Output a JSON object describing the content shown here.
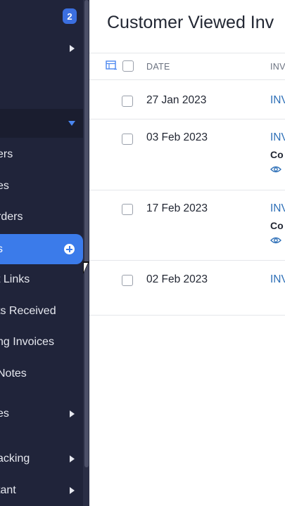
{
  "sidebar": {
    "badge": "2",
    "items": [
      {
        "label": "ers"
      },
      {
        "label": "es"
      },
      {
        "label": "rders"
      },
      {
        "label": "s"
      },
      {
        "label": "t Links"
      },
      {
        "label": "ts Received"
      },
      {
        "label": "ng Invoices"
      },
      {
        "label": "Notes"
      },
      {
        "label": "es"
      },
      {
        "label": "acking"
      },
      {
        "label": "tant"
      }
    ]
  },
  "main": {
    "title": "Customer Viewed Inv",
    "columns": {
      "date": "DATE",
      "invoice": "INV"
    },
    "rows": [
      {
        "date": "27 Jan 2023",
        "invoice": "INV"
      },
      {
        "date": "03 Feb 2023",
        "invoice": "INV",
        "sub": "Co"
      },
      {
        "date": "17 Feb 2023",
        "invoice": "INV",
        "sub": "Co"
      },
      {
        "date": "02 Feb 2023",
        "invoice": "INV"
      }
    ]
  },
  "colors": {
    "sidebar_bg": "#20243a",
    "accent": "#3b7bea",
    "link": "#2d6fb7"
  }
}
